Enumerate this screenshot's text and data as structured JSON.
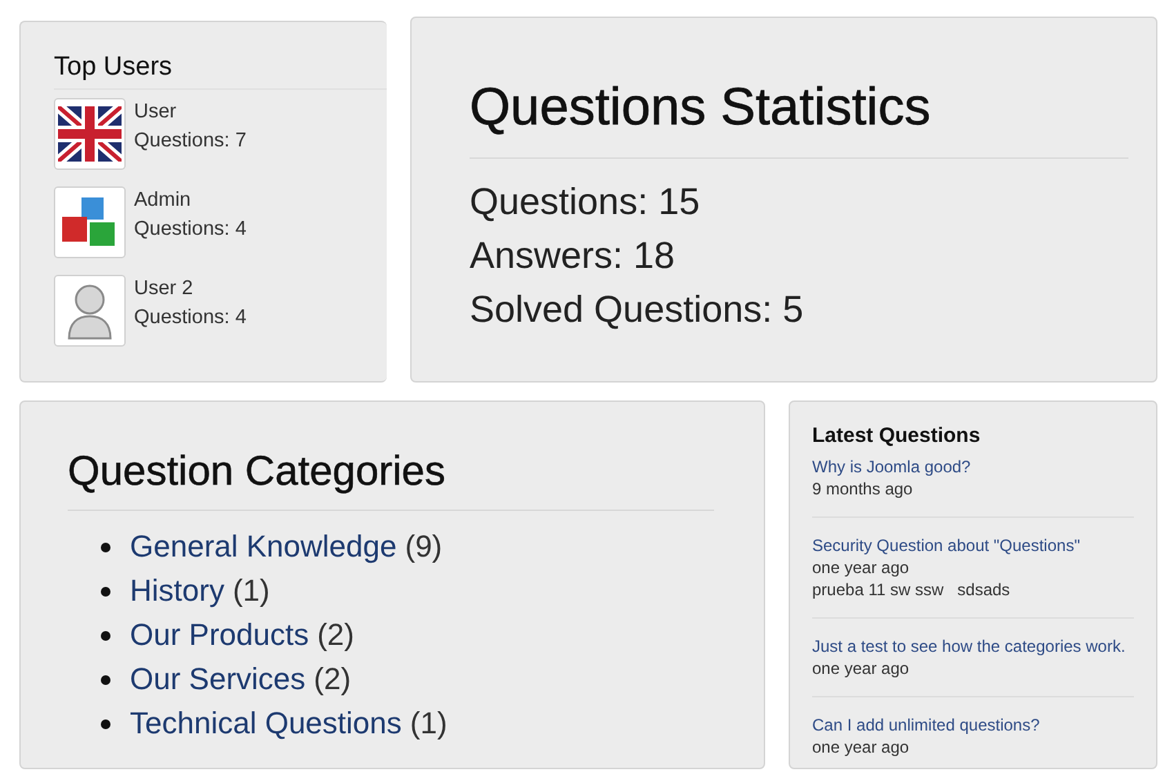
{
  "top_users": {
    "title": "Top Users",
    "users": [
      {
        "name": "User",
        "questions": "Questions: 7"
      },
      {
        "name": "Admin",
        "questions": "Questions: 4"
      },
      {
        "name": "User 2",
        "questions": "Questions: 4"
      }
    ]
  },
  "statistics": {
    "title": "Questions Statistics",
    "lines": [
      "Questions: 15",
      "Answers: 18",
      "Solved Questions: 5"
    ]
  },
  "categories": {
    "title": "Question Categories",
    "items": [
      {
        "name": "General Knowledge",
        "count": "(9)"
      },
      {
        "name": "History",
        "count": "(1)"
      },
      {
        "name": "Our Products",
        "count": "(2)"
      },
      {
        "name": "Our Services",
        "count": "(2)"
      },
      {
        "name": "Technical Questions",
        "count": "(1)"
      }
    ]
  },
  "latest_questions": {
    "title": "Latest Questions",
    "items": [
      {
        "title": "Why is Joomla good?",
        "time": "9 months ago"
      },
      {
        "title": "Security Question about \"Questions\"",
        "time": "one year ago",
        "excerpt": "prueba 11 sw ssw   sdsads"
      },
      {
        "title": "Just a test to see how the categories work.",
        "time": "one year ago"
      },
      {
        "title": "Can I add unlimited questions?",
        "time": "one year ago"
      }
    ]
  }
}
